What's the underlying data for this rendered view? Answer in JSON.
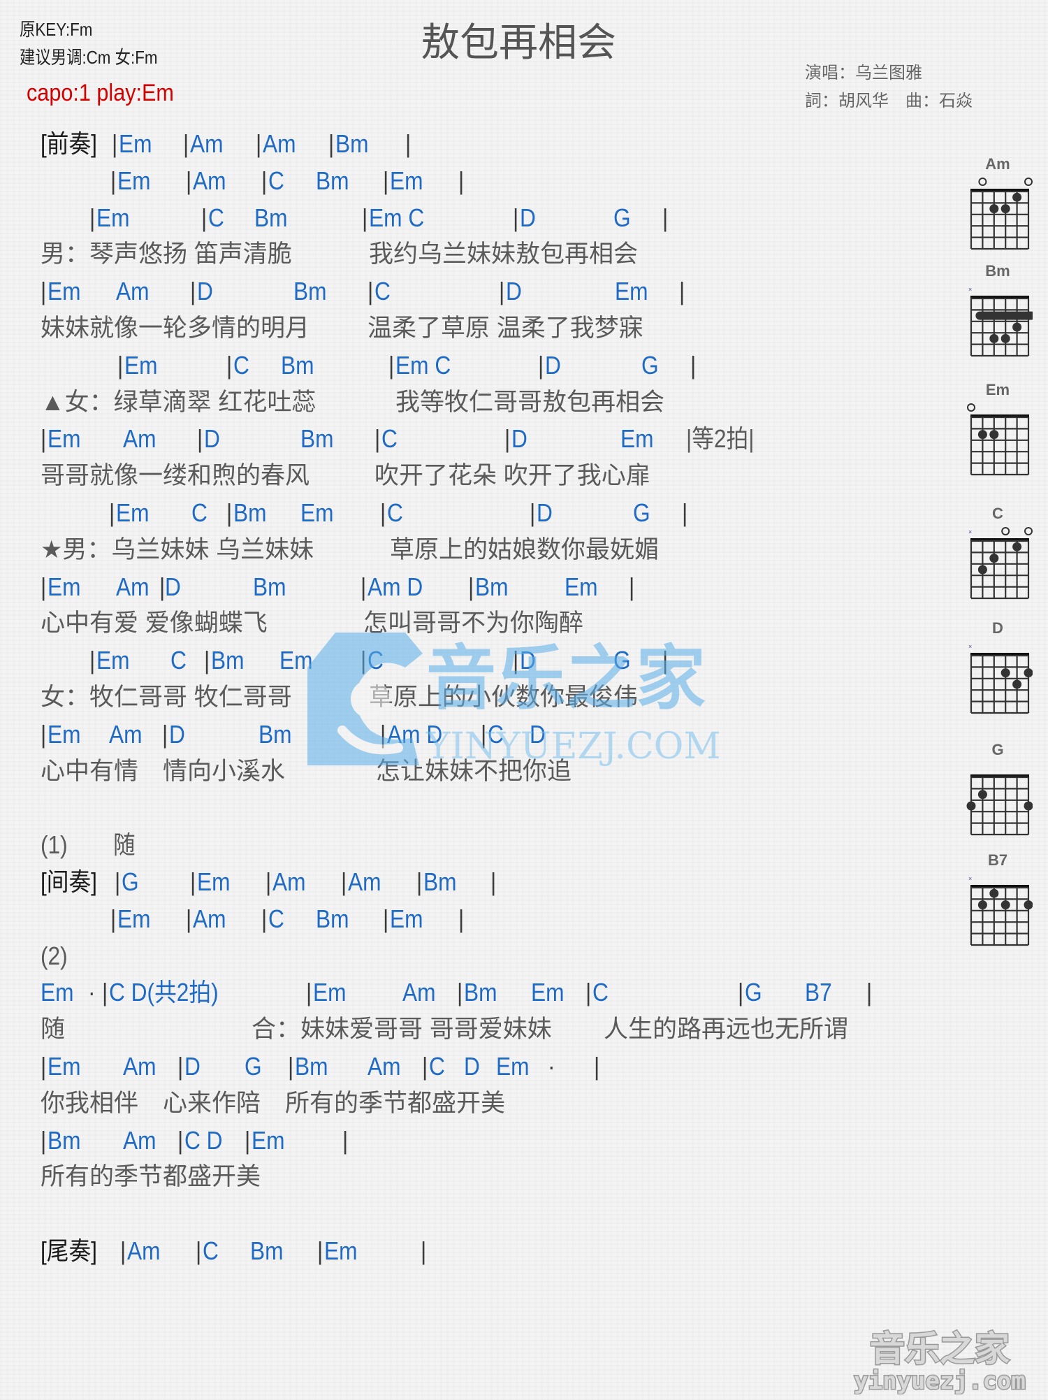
{
  "header": {
    "original_key": "原KEY:Fm",
    "suggested_key": "建议男调:Cm 女:Fm",
    "capo": "capo:1 play:Em",
    "title": "敖包再相会",
    "singer": "演唱：乌兰图雅",
    "writers": "詞：胡风华　曲：石焱"
  },
  "sheet_lines": [
    {
      "type": "chord",
      "tokens": [
        [
          "label",
          "[前奏]"
        ],
        [
          "bar",
          "|"
        ],
        [
          "chord",
          "Em"
        ],
        [
          "bar",
          "|"
        ],
        [
          "chord",
          "Am"
        ],
        [
          "bar",
          "|"
        ],
        [
          "chord",
          "Am"
        ],
        [
          "bar",
          "|"
        ],
        [
          "chord",
          "Bm"
        ],
        [
          "bar",
          "|"
        ]
      ],
      "x": [
        58,
        160,
        170,
        262,
        272,
        366,
        376,
        470,
        480,
        580
      ]
    },
    {
      "type": "chord",
      "tokens": [
        [
          "bar",
          "|"
        ],
        [
          "chord",
          "Em"
        ],
        [
          "bar",
          "|"
        ],
        [
          "chord",
          "Am"
        ],
        [
          "bar",
          "|"
        ],
        [
          "chord",
          "C"
        ],
        [
          "chord",
          "Bm"
        ],
        [
          "bar",
          "|"
        ],
        [
          "chord",
          "Em"
        ],
        [
          "bar",
          "|"
        ]
      ],
      "x": [
        158,
        168,
        266,
        276,
        374,
        384,
        452,
        548,
        558,
        656
      ]
    },
    {
      "type": "chord",
      "tokens": [
        [
          "bar",
          "|"
        ],
        [
          "chord",
          "Em"
        ],
        [
          "bar",
          "|"
        ],
        [
          "chord",
          "C"
        ],
        [
          "chord",
          "Bm"
        ],
        [
          "bar",
          "|"
        ],
        [
          "chord",
          "Em C"
        ],
        [
          "bar",
          "|"
        ],
        [
          "chord",
          "D"
        ],
        [
          "chord",
          "G"
        ],
        [
          "bar",
          "|"
        ]
      ],
      "x": [
        128,
        138,
        288,
        298,
        364,
        518,
        528,
        734,
        744,
        878,
        948
      ]
    },
    {
      "type": "lyric",
      "tokens": [
        [
          "lyric",
          "男：琴声悠扬 笛声清脆"
        ],
        [
          "lyric",
          "我约乌兰妹妹敖包再相会"
        ]
      ],
      "x": [
        58,
        528
      ]
    },
    {
      "type": "chord",
      "tokens": [
        [
          "bar",
          "|"
        ],
        [
          "chord",
          "Em"
        ],
        [
          "chord",
          "Am"
        ],
        [
          "bar",
          "|"
        ],
        [
          "chord",
          "D"
        ],
        [
          "chord",
          "Bm"
        ],
        [
          "bar",
          "|"
        ],
        [
          "chord",
          "C"
        ],
        [
          "bar",
          "|"
        ],
        [
          "chord",
          "D"
        ],
        [
          "chord",
          "Em"
        ],
        [
          "bar",
          "|"
        ]
      ],
      "x": [
        58,
        68,
        166,
        272,
        282,
        420,
        526,
        536,
        714,
        724,
        880,
        972
      ]
    },
    {
      "type": "lyric",
      "tokens": [
        [
          "lyric",
          "妹妹就像一轮多情的明月"
        ],
        [
          "lyric",
          "温柔了草原 温柔了我梦寐"
        ]
      ],
      "x": [
        58,
        526
      ]
    },
    {
      "type": "chord",
      "tokens": [
        [
          "bar",
          "|"
        ],
        [
          "chord",
          "Em"
        ],
        [
          "bar",
          "|"
        ],
        [
          "chord",
          "C"
        ],
        [
          "chord",
          "Bm"
        ],
        [
          "bar",
          "|"
        ],
        [
          "chord",
          "Em C"
        ],
        [
          "bar",
          "|"
        ],
        [
          "chord",
          "D"
        ],
        [
          "chord",
          "G"
        ],
        [
          "bar",
          "|"
        ]
      ],
      "x": [
        168,
        178,
        324,
        334,
        402,
        556,
        566,
        770,
        780,
        918,
        988
      ]
    },
    {
      "type": "lyric",
      "tokens": [
        [
          "lyric",
          "▲女：绿草滴翠 红花吐蕊"
        ],
        [
          "lyric",
          "我等牧仁哥哥敖包再相会"
        ]
      ],
      "x": [
        58,
        566
      ]
    },
    {
      "type": "chord",
      "tokens": [
        [
          "bar",
          "|"
        ],
        [
          "chord",
          "Em"
        ],
        [
          "chord",
          "Am"
        ],
        [
          "bar",
          "|"
        ],
        [
          "chord",
          "D"
        ],
        [
          "chord",
          "Bm"
        ],
        [
          "bar",
          "|"
        ],
        [
          "chord",
          "C"
        ],
        [
          "bar",
          "|"
        ],
        [
          "chord",
          "D"
        ],
        [
          "chord",
          "Em"
        ],
        [
          "note",
          "|等2拍|"
        ]
      ],
      "x": [
        58,
        68,
        176,
        282,
        292,
        430,
        536,
        546,
        722,
        732,
        888,
        982
      ]
    },
    {
      "type": "lyric",
      "tokens": [
        [
          "lyric",
          "哥哥就像一缕和煦的春风"
        ],
        [
          "lyric",
          "吹开了花朵 吹开了我心扉"
        ]
      ],
      "x": [
        58,
        536
      ]
    },
    {
      "type": "chord",
      "tokens": [
        [
          "bar",
          "|"
        ],
        [
          "chord",
          "Em"
        ],
        [
          "chord",
          "C"
        ],
        [
          "bar",
          "|"
        ],
        [
          "chord",
          "Bm"
        ],
        [
          "chord",
          "Em"
        ],
        [
          "bar",
          "|"
        ],
        [
          "chord",
          "C"
        ],
        [
          "bar",
          "|"
        ],
        [
          "chord",
          "D"
        ],
        [
          "chord",
          "G"
        ],
        [
          "bar",
          "|"
        ]
      ],
      "x": [
        156,
        166,
        274,
        324,
        334,
        430,
        544,
        554,
        758,
        768,
        906,
        976
      ]
    },
    {
      "type": "lyric",
      "tokens": [
        [
          "lyric",
          "★男：乌兰妹妹 乌兰妹妹"
        ],
        [
          "lyric",
          "草原上的姑娘数你最妩媚"
        ]
      ],
      "x": [
        58,
        558
      ]
    },
    {
      "type": "chord",
      "tokens": [
        [
          "bar",
          "|"
        ],
        [
          "chord",
          "Em"
        ],
        [
          "chord",
          "Am"
        ],
        [
          "bar",
          "|"
        ],
        [
          "chord",
          "D"
        ],
        [
          "chord",
          "Bm"
        ],
        [
          "bar",
          "|"
        ],
        [
          "chord",
          "Am D"
        ],
        [
          "bar",
          "|"
        ],
        [
          "chord",
          "Bm"
        ],
        [
          "chord",
          "Em"
        ],
        [
          "bar",
          "|"
        ]
      ],
      "x": [
        58,
        68,
        166,
        228,
        236,
        362,
        516,
        526,
        670,
        680,
        808,
        900
      ]
    },
    {
      "type": "lyric",
      "tokens": [
        [
          "lyric",
          "心中有爱 爱像蝴蝶飞"
        ],
        [
          "lyric",
          "怎叫哥哥不为你陶醉"
        ]
      ],
      "x": [
        58,
        520
      ]
    },
    {
      "type": "chord",
      "tokens": [
        [
          "bar",
          "|"
        ],
        [
          "chord",
          "Em"
        ],
        [
          "chord",
          "C"
        ],
        [
          "bar",
          "|"
        ],
        [
          "chord",
          "Bm"
        ],
        [
          "chord",
          "Em"
        ],
        [
          "bar",
          "|"
        ],
        [
          "chord",
          "C"
        ],
        [
          "bar",
          "|"
        ],
        [
          "chord",
          "D"
        ],
        [
          "chord",
          "G"
        ],
        [
          "bar",
          "|"
        ]
      ],
      "x": [
        128,
        138,
        244,
        292,
        302,
        400,
        516,
        526,
        734,
        744,
        878,
        948
      ]
    },
    {
      "type": "lyric",
      "tokens": [
        [
          "lyric",
          "女：牧仁哥哥 牧仁哥哥"
        ],
        [
          "lyric",
          "草原上的小伙数你最俊伟"
        ]
      ],
      "x": [
        58,
        528
      ]
    },
    {
      "type": "chord",
      "tokens": [
        [
          "bar",
          "|"
        ],
        [
          "chord",
          "Em"
        ],
        [
          "chord",
          "Am"
        ],
        [
          "bar",
          "|"
        ],
        [
          "chord",
          "D"
        ],
        [
          "chord",
          "Bm"
        ],
        [
          "bar",
          "|"
        ],
        [
          "chord",
          "Am D"
        ],
        [
          "bar",
          "|"
        ],
        [
          "chord",
          "C"
        ],
        [
          "chord",
          "D"
        ]
      ],
      "x": [
        58,
        68,
        156,
        232,
        242,
        370,
        544,
        554,
        688,
        698,
        758
      ]
    },
    {
      "type": "lyric",
      "tokens": [
        [
          "lyric",
          "心中有情　情向小溪水"
        ],
        [
          "lyric",
          "怎让妹妹不把你追"
        ]
      ],
      "x": [
        58,
        538
      ]
    },
    {
      "type": "blank"
    },
    {
      "type": "chord",
      "tokens": [
        [
          "note",
          "(1)"
        ],
        [
          "note",
          "随"
        ]
      ],
      "x": [
        58,
        162
      ]
    },
    {
      "type": "chord",
      "tokens": [
        [
          "label",
          "[间奏]"
        ],
        [
          "bar",
          "|"
        ],
        [
          "chord",
          "G"
        ],
        [
          "bar",
          "|"
        ],
        [
          "chord",
          "Em"
        ],
        [
          "bar",
          "|"
        ],
        [
          "chord",
          "Am"
        ],
        [
          "bar",
          "|"
        ],
        [
          "chord",
          "Am"
        ],
        [
          "bar",
          "|"
        ],
        [
          "chord",
          "Bm"
        ],
        [
          "bar",
          "|"
        ]
      ],
      "x": [
        58,
        164,
        174,
        272,
        282,
        380,
        390,
        488,
        498,
        596,
        606,
        702
      ]
    },
    {
      "type": "chord",
      "tokens": [
        [
          "bar",
          "|"
        ],
        [
          "chord",
          "Em"
        ],
        [
          "bar",
          "|"
        ],
        [
          "chord",
          "Am"
        ],
        [
          "bar",
          "|"
        ],
        [
          "chord",
          "C"
        ],
        [
          "chord",
          "Bm"
        ],
        [
          "bar",
          "|"
        ],
        [
          "chord",
          "Em"
        ],
        [
          "bar",
          "|"
        ]
      ],
      "x": [
        158,
        168,
        266,
        276,
        374,
        384,
        452,
        548,
        558,
        656
      ]
    },
    {
      "type": "chord",
      "tokens": [
        [
          "note",
          "(2)"
        ]
      ],
      "x": [
        58
      ]
    },
    {
      "type": "chord",
      "tokens": [
        [
          "chord",
          "Em"
        ],
        [
          "bar",
          "·"
        ],
        [
          "bar",
          "|"
        ],
        [
          "chord",
          "C D(共2拍)"
        ],
        [
          "bar",
          "|"
        ],
        [
          "chord",
          "Em"
        ],
        [
          "chord",
          "Am"
        ],
        [
          "bar",
          "|"
        ],
        [
          "chord",
          "Bm"
        ],
        [
          "chord",
          "Em"
        ],
        [
          "bar",
          "|"
        ],
        [
          "chord",
          "C"
        ],
        [
          "bar",
          "|"
        ],
        [
          "chord",
          "G"
        ],
        [
          "chord",
          "B7"
        ],
        [
          "bar",
          "|"
        ]
      ],
      "x": [
        58,
        126,
        146,
        156,
        438,
        448,
        576,
        654,
        664,
        760,
        838,
        848,
        1056,
        1066,
        1152,
        1240
      ]
    },
    {
      "type": "lyric",
      "tokens": [
        [
          "lyric",
          "随"
        ],
        [
          "lyric",
          "合：妹妹爱哥哥 哥哥爱妹妹"
        ],
        [
          "lyric",
          "人生的路再远也无所谓"
        ]
      ],
      "x": [
        58,
        360,
        864
      ]
    },
    {
      "type": "chord",
      "tokens": [
        [
          "bar",
          "|"
        ],
        [
          "chord",
          "Em"
        ],
        [
          "chord",
          "Am"
        ],
        [
          "bar",
          "|"
        ],
        [
          "chord",
          "D"
        ],
        [
          "chord",
          "G"
        ],
        [
          "bar",
          "|"
        ],
        [
          "chord",
          "Bm"
        ],
        [
          "chord",
          "Am"
        ],
        [
          "bar",
          "|"
        ],
        [
          "chord",
          "C"
        ],
        [
          "chord",
          "D"
        ],
        [
          "chord",
          "Em"
        ],
        [
          "bar",
          "·"
        ],
        [
          "bar",
          "|"
        ]
      ],
      "x": [
        58,
        68,
        176,
        254,
        264,
        350,
        412,
        422,
        526,
        604,
        614,
        664,
        710,
        784,
        850
      ]
    },
    {
      "type": "lyric",
      "tokens": [
        [
          "lyric",
          "你我相伴　心来作陪　所有的季节都盛开美"
        ]
      ],
      "x": [
        58
      ]
    },
    {
      "type": "chord",
      "tokens": [
        [
          "bar",
          "|"
        ],
        [
          "chord",
          "Bm"
        ],
        [
          "chord",
          "Am"
        ],
        [
          "bar",
          "|"
        ],
        [
          "chord",
          "C D"
        ],
        [
          "bar",
          "|"
        ],
        [
          "chord",
          "Em"
        ],
        [
          "bar",
          "|"
        ]
      ],
      "x": [
        58,
        68,
        176,
        254,
        264,
        350,
        360,
        490
      ]
    },
    {
      "type": "lyric",
      "tokens": [
        [
          "lyric",
          "所有的季节都盛开美"
        ]
      ],
      "x": [
        58
      ]
    },
    {
      "type": "blank"
    },
    {
      "type": "chord",
      "tokens": [
        [
          "label",
          "[尾奏]"
        ],
        [
          "bar",
          "|"
        ],
        [
          "chord",
          "Am"
        ],
        [
          "bar",
          "|"
        ],
        [
          "chord",
          "C"
        ],
        [
          "chord",
          "Bm"
        ],
        [
          "bar",
          "|"
        ],
        [
          "chord",
          "Em"
        ],
        [
          "bar",
          "|"
        ]
      ],
      "x": [
        58,
        172,
        182,
        280,
        290,
        358,
        454,
        464,
        602
      ]
    }
  ],
  "chord_diagrams": [
    {
      "name": "Am",
      "open": [
        1,
        5
      ],
      "muted": [],
      "dots": [
        [
          4,
          1
        ],
        [
          2,
          2
        ],
        [
          3,
          2
        ]
      ],
      "barre": null
    },
    {
      "name": "Bm",
      "open": [],
      "muted": [
        0
      ],
      "dots": [
        [
          4,
          3
        ],
        [
          2,
          4
        ],
        [
          3,
          4
        ]
      ],
      "barre": [
        2,
        1,
        5
      ]
    },
    {
      "name": "Em",
      "open": [
        0
      ],
      "muted": [],
      "dots": [
        [
          1,
          2
        ],
        [
          2,
          2
        ]
      ],
      "barre": null
    },
    {
      "name": "C",
      "open": [
        3,
        5
      ],
      "muted": [
        0
      ],
      "dots": [
        [
          4,
          1
        ],
        [
          2,
          2
        ],
        [
          1,
          3
        ]
      ],
      "barre": null
    },
    {
      "name": "D",
      "open": [],
      "muted": [
        0
      ],
      "dots": [
        [
          3,
          2
        ],
        [
          5,
          2
        ],
        [
          4,
          3
        ]
      ],
      "barre": null
    },
    {
      "name": "G",
      "open": [],
      "muted": [],
      "dots": [
        [
          1,
          2
        ],
        [
          0,
          3
        ],
        [
          5,
          3
        ]
      ],
      "barre": null
    },
    {
      "name": "B7",
      "open": [],
      "muted": [
        0
      ],
      "dots": [
        [
          2,
          1
        ],
        [
          1,
          2
        ],
        [
          3,
          2
        ],
        [
          5,
          2
        ]
      ],
      "barre": null
    }
  ],
  "watermark": {
    "site_cn": "音乐之家",
    "site_en": "YINYUEZJ.COM"
  },
  "footer": {
    "logo_cn": "音乐之家",
    "logo_en": "yinyuezj.com"
  },
  "colors": {
    "chord": "#1f6ac4",
    "capo": "#d40000",
    "lyric": "#5a5a5a",
    "label": "#1a1a1a"
  }
}
